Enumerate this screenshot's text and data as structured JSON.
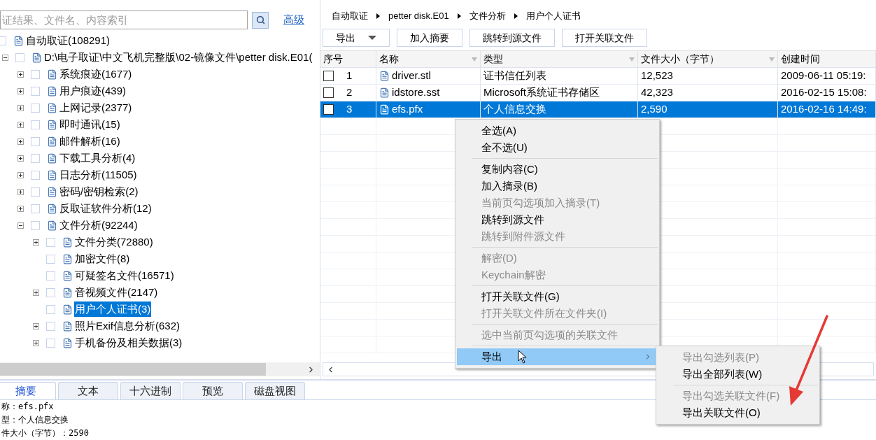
{
  "search": {
    "placeholder": "证结果、文件名、内容索引",
    "advanced": "高级"
  },
  "tree": [
    {
      "label": "自动取证(108291)",
      "checked": false,
      "selected": false,
      "children": [
        {
          "label": "D:\\电子取证\\中文飞机完整版\\02-镜像文件\\petter disk.E01(",
          "checked": false,
          "selected": false,
          "expanded": true,
          "children": [
            {
              "label": "系统痕迹(1677)",
              "checked": false,
              "selected": false,
              "expanded": false
            },
            {
              "label": "用户痕迹(439)",
              "checked": false,
              "selected": false,
              "expanded": false
            },
            {
              "label": "上网记录(2377)",
              "checked": false,
              "selected": false,
              "expanded": false
            },
            {
              "label": "即时通讯(15)",
              "checked": false,
              "selected": false,
              "expanded": false
            },
            {
              "label": "邮件解析(16)",
              "checked": false,
              "selected": false,
              "expanded": false
            },
            {
              "label": "下载工具分析(4)",
              "checked": false,
              "selected": false,
              "expanded": false
            },
            {
              "label": "日志分析(11505)",
              "checked": false,
              "selected": false,
              "expanded": false
            },
            {
              "label": "密码/密钥检索(2)",
              "checked": false,
              "selected": false,
              "expanded": false
            },
            {
              "label": "反取证软件分析(12)",
              "checked": false,
              "selected": false,
              "expanded": false
            },
            {
              "label": "文件分析(92244)",
              "checked": false,
              "selected": false,
              "expanded": true,
              "children": [
                {
                  "label": "文件分类(72880)",
                  "checked": false,
                  "selected": false,
                  "expanded": false
                },
                {
                  "label": "加密文件(8)",
                  "checked": false,
                  "selected": false
                },
                {
                  "label": "可疑签名文件(16571)",
                  "checked": false,
                  "selected": false
                },
                {
                  "label": "音视频文件(2147)",
                  "checked": false,
                  "selected": false,
                  "expanded": false
                },
                {
                  "label": "用户个人证书(3)",
                  "checked": false,
                  "selected": true
                },
                {
                  "label": "照片Exif信息分析(632)",
                  "checked": false,
                  "selected": false,
                  "expanded": false
                },
                {
                  "label": "手机备份及相关数据(3)",
                  "checked": false,
                  "selected": false,
                  "expanded": false
                }
              ]
            }
          ]
        }
      ]
    }
  ],
  "breadcrumb": [
    "自动取证",
    "petter disk.E01",
    "文件分析",
    "用户个人证书"
  ],
  "toolbar": [
    {
      "label": "导出",
      "kind": "dropdown"
    },
    {
      "label": "加入摘要",
      "kind": "button"
    },
    {
      "label": "跳转到源文件",
      "kind": "button"
    },
    {
      "label": "打开关联文件",
      "kind": "button"
    }
  ],
  "table": {
    "columns": [
      {
        "label": "序号",
        "filter": false
      },
      {
        "label": "名称",
        "filter": true
      },
      {
        "label": "类型",
        "filter": true
      },
      {
        "label": "文件大小（字节）",
        "filter": true
      },
      {
        "label": "创建时间",
        "filter": false
      }
    ],
    "rows": [
      {
        "index": "1",
        "name": "driver.stl",
        "type": "证书信任列表",
        "size": "12,523",
        "created": "2009-06-11 05:19:",
        "checked": false,
        "selected": false
      },
      {
        "index": "2",
        "name": "idstore.sst",
        "type": "Microsoft系统证书存储区",
        "size": "42,323",
        "created": "2016-02-15 15:08:",
        "checked": false,
        "selected": false
      },
      {
        "index": "3",
        "name": "efs.pfx",
        "type": "个人信息交换",
        "size": "2,590",
        "created": "2016-02-16 14:49:",
        "checked": false,
        "selected": true
      }
    ]
  },
  "context_menu": [
    {
      "kind": "item",
      "label": "全选(A)",
      "disabled": false,
      "selected": false
    },
    {
      "kind": "item",
      "label": "全不选(U)",
      "disabled": false,
      "selected": false
    },
    {
      "kind": "separator"
    },
    {
      "kind": "item",
      "label": "复制内容(C)",
      "disabled": false,
      "selected": false
    },
    {
      "kind": "item",
      "label": "加入摘录(B)",
      "disabled": false,
      "selected": false
    },
    {
      "kind": "item",
      "label": "当前页勾选项加入摘录(T)",
      "disabled": true,
      "selected": false
    },
    {
      "kind": "item",
      "label": "跳转到源文件",
      "disabled": false,
      "selected": false
    },
    {
      "kind": "item",
      "label": "跳转到附件源文件",
      "disabled": true,
      "selected": false
    },
    {
      "kind": "separator"
    },
    {
      "kind": "item",
      "label": "解密(D)",
      "disabled": true,
      "selected": false
    },
    {
      "kind": "item",
      "label": "Keychain解密",
      "disabled": true,
      "selected": false
    },
    {
      "kind": "separator"
    },
    {
      "kind": "item",
      "label": "打开关联文件(G)",
      "disabled": false,
      "selected": false
    },
    {
      "kind": "item",
      "label": "打开关联文件所在文件夹(I)",
      "disabled": true,
      "selected": false
    },
    {
      "kind": "separator"
    },
    {
      "kind": "item",
      "label": "选中当前页勾选项的关联文件",
      "disabled": true,
      "selected": false
    },
    {
      "kind": "separator"
    },
    {
      "kind": "submenu",
      "label": "导出",
      "disabled": false,
      "selected": true
    }
  ],
  "submenu": [
    {
      "kind": "item",
      "label": "导出勾选列表(P)",
      "disabled": true
    },
    {
      "kind": "item",
      "label": "导出全部列表(W)",
      "disabled": false
    },
    {
      "kind": "separator"
    },
    {
      "kind": "item",
      "label": "导出勾选关联文件(F)",
      "disabled": true
    },
    {
      "kind": "item",
      "label": "导出关联文件(O)",
      "disabled": false
    }
  ],
  "bottom_tabs": [
    {
      "label": "摘要",
      "selected": true
    },
    {
      "label": "文本",
      "selected": false
    },
    {
      "label": "十六进制",
      "selected": false
    },
    {
      "label": "预览",
      "selected": false
    },
    {
      "label": "磁盘视图",
      "selected": false
    }
  ],
  "summary": [
    "称：efs.pfx",
    "型：个人信息交换",
    "件大小（字节）：2590"
  ]
}
